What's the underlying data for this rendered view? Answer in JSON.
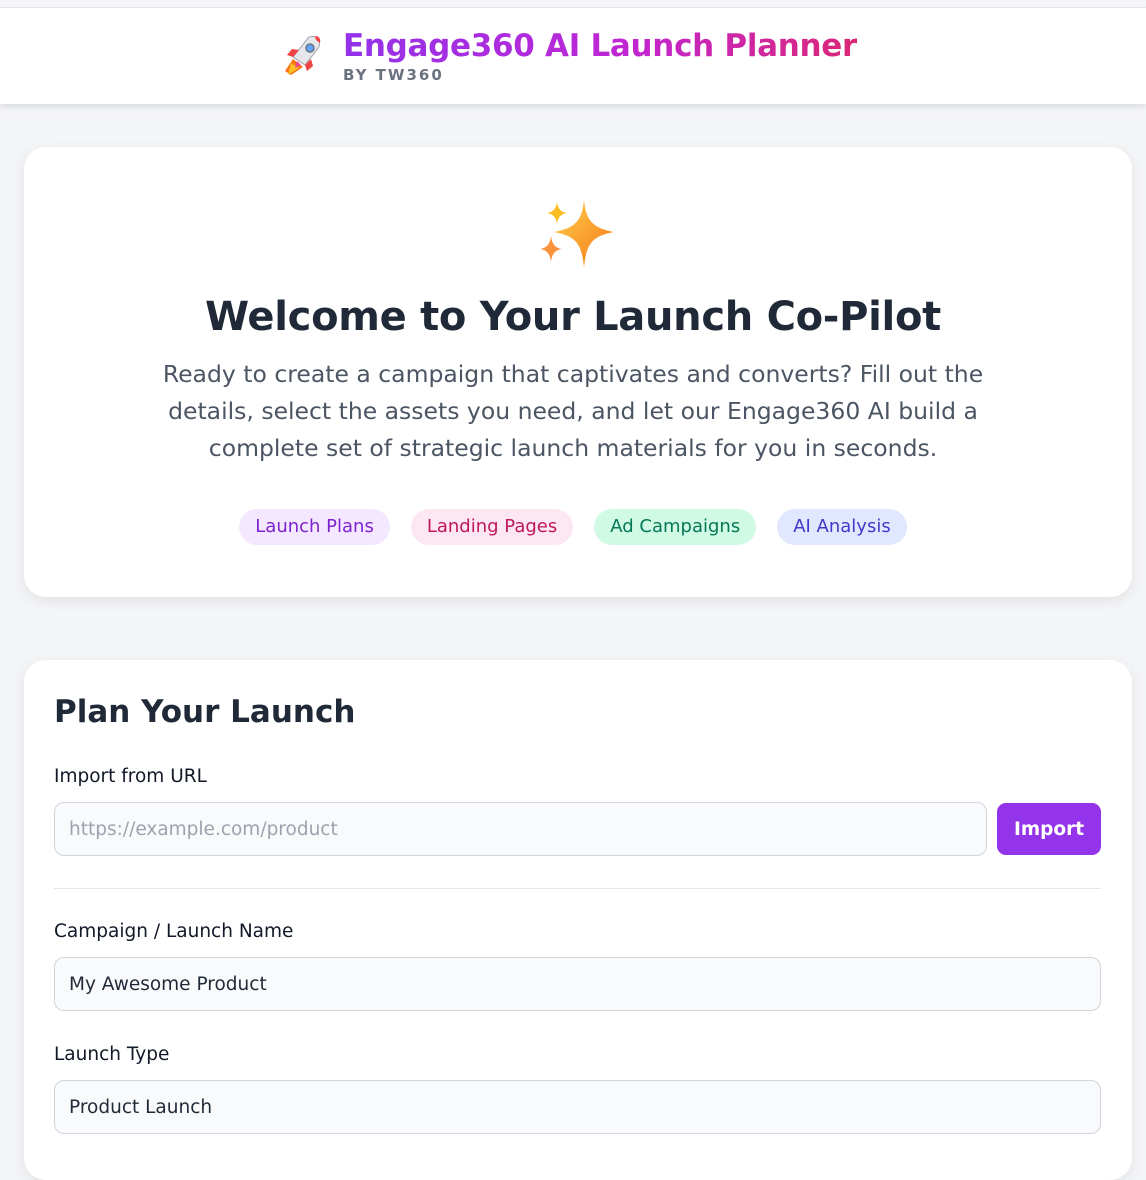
{
  "header": {
    "title": "Engage360 AI Launch Planner",
    "subtitle": "BY TW360",
    "icon": "rocket-icon"
  },
  "welcome": {
    "icon": "sparkles-icon",
    "title": "Welcome to Your Launch Co-Pilot",
    "description": "Ready to create a campaign that captivates and converts? Fill out the details, select the assets you need, and let our Engage360 AI build a complete set of strategic launch materials for you in seconds.",
    "chips": [
      {
        "label": "Launch Plans",
        "color": "#7e22ce"
      },
      {
        "label": "Landing Pages",
        "color": "#be185d"
      },
      {
        "label": "Ad Campaigns",
        "color": "#047857"
      },
      {
        "label": "AI Analysis",
        "color": "#4338ca"
      }
    ]
  },
  "plan": {
    "title": "Plan Your Launch",
    "import_label": "Import from URL",
    "import_placeholder": "https://example.com/product",
    "import_button": "Import",
    "campaign_label": "Campaign / Launch Name",
    "campaign_value": "My Awesome Product",
    "type_label": "Launch Type",
    "type_value": "Product Launch"
  },
  "colors": {
    "accent": "#9333ea",
    "brand_gradient_start": "#9333ea",
    "brand_gradient_end": "#db2777"
  }
}
